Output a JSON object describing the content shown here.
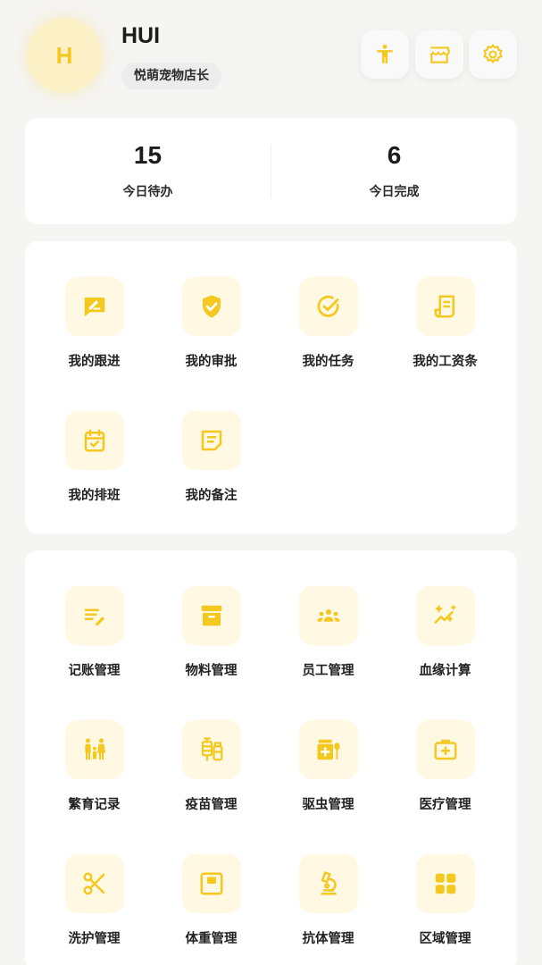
{
  "profile": {
    "avatar_letter": "H",
    "username": "HUI",
    "role": "悦萌宠物店长"
  },
  "header_actions": [
    {
      "icon": "accessibility-icon"
    },
    {
      "icon": "store-icon"
    },
    {
      "icon": "gear-icon"
    }
  ],
  "stats": [
    {
      "value": "15",
      "label": "今日待办"
    },
    {
      "value": "6",
      "label": "今日完成"
    }
  ],
  "personal_menu": [
    {
      "label": "我的跟进",
      "icon": "edit-note-icon"
    },
    {
      "label": "我的审批",
      "icon": "shield-check-icon"
    },
    {
      "label": "我的任务",
      "icon": "check-circle-icon"
    },
    {
      "label": "我的工资条",
      "icon": "receipt-icon"
    },
    {
      "label": "我的排班",
      "icon": "calendar-check-icon"
    },
    {
      "label": "我的备注",
      "icon": "note-icon"
    }
  ],
  "management_menu": [
    {
      "label": "记账管理",
      "icon": "bookkeeping-icon"
    },
    {
      "label": "物料管理",
      "icon": "archive-box-icon"
    },
    {
      "label": "员工管理",
      "icon": "team-icon"
    },
    {
      "label": "血缘计算",
      "icon": "sparkle-chart-icon"
    },
    {
      "label": "繁育记录",
      "icon": "family-icon"
    },
    {
      "label": "疫苗管理",
      "icon": "vaccine-icon"
    },
    {
      "label": "驱虫管理",
      "icon": "medicine-icon"
    },
    {
      "label": "医疗管理",
      "icon": "medical-kit-icon"
    },
    {
      "label": "洗护管理",
      "icon": "scissors-icon"
    },
    {
      "label": "体重管理",
      "icon": "scale-icon"
    },
    {
      "label": "抗体管理",
      "icon": "microscope-icon"
    },
    {
      "label": "区域管理",
      "icon": "grid-icon"
    }
  ],
  "colors": {
    "accent": "#f5c81f",
    "icon_bg": "#fff8e3",
    "page_bg": "#f5f5f3"
  }
}
